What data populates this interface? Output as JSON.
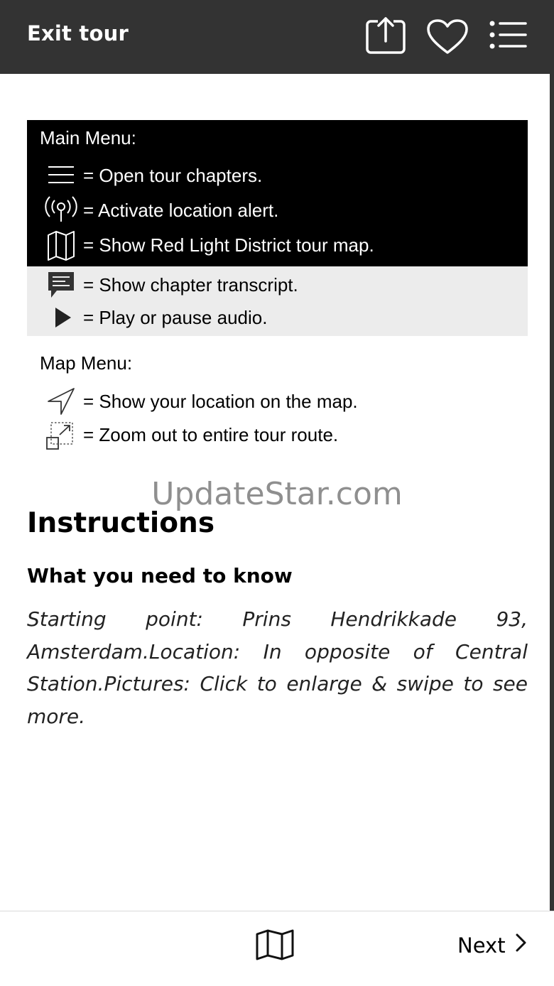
{
  "header": {
    "exit_label": "Exit tour",
    "icons": [
      "share-icon",
      "heart-icon",
      "menu-list-icon"
    ]
  },
  "legend": {
    "main_menu_title": "Main Menu:",
    "main_items": [
      {
        "icon": "hamburger-icon",
        "text": "= Open tour chapters."
      },
      {
        "icon": "location-alert-icon",
        "text": "= Activate location alert."
      },
      {
        "icon": "map-icon",
        "text": "= Show Red Light District tour map."
      }
    ],
    "player_items": [
      {
        "icon": "transcript-icon",
        "text": "= Show chapter transcript."
      },
      {
        "icon": "play-icon",
        "text": "= Play or pause audio."
      }
    ],
    "map_menu_title": "Map Menu:",
    "map_items": [
      {
        "icon": "navigation-arrow-icon",
        "text": "= Show your location on the map."
      },
      {
        "icon": "zoom-out-route-icon",
        "text": "= Zoom out to entire tour route."
      }
    ]
  },
  "watermark": "UpdateStar.com",
  "content": {
    "title": "Instructions",
    "subtitle": "What you need to know",
    "body": "Starting point: Prins Hendrikkade 93, Amsterdam.Location: In opposite of Central Station.Pictures: Click to enlarge & swipe to see more."
  },
  "footer": {
    "map_icon": "map-icon",
    "next_label": "Next",
    "next_icon": "chevron-right-icon"
  },
  "colors": {
    "header_bg": "#333333",
    "legend_black": "#000000",
    "legend_gray": "#ececec",
    "watermark": "#8f8f8f"
  }
}
